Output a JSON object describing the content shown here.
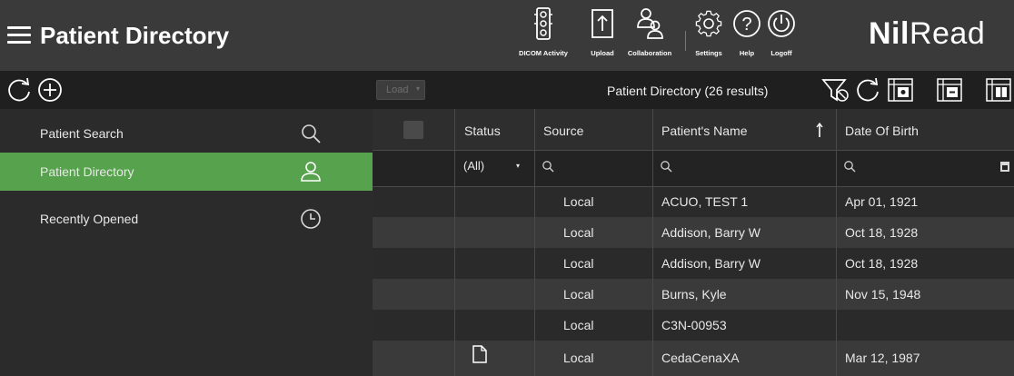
{
  "header": {
    "title": "Patient Directory",
    "brand_bold": "Nil",
    "brand_light": "Read",
    "tools": [
      {
        "label": "DICOM Activity",
        "icon": "traffic-light-icon"
      },
      {
        "label": "Upload",
        "icon": "upload-icon"
      },
      {
        "label": "Collaboration",
        "icon": "users-icon"
      },
      {
        "label": "Settings",
        "icon": "gear-icon"
      },
      {
        "label": "Help",
        "icon": "help-icon"
      },
      {
        "label": "Logoff",
        "icon": "power-icon"
      }
    ]
  },
  "actionbar": {
    "load_label": "Load",
    "results_text": "Patient Directory (26 results)"
  },
  "sidebar": {
    "items": [
      {
        "label": "Patient Search",
        "icon": "search-icon"
      },
      {
        "label": "Patient Directory",
        "icon": "user-icon",
        "active": true
      },
      {
        "label": "Recently Opened",
        "icon": "clock-icon"
      }
    ]
  },
  "table": {
    "columns": [
      "Status",
      "Source",
      "Patient's Name",
      "Date Of Birth"
    ],
    "status_filter": "(All)",
    "rows": [
      {
        "status_icon": "",
        "source": "Local",
        "name": "ACUO, TEST 1",
        "dob": "Apr 01, 1921"
      },
      {
        "status_icon": "",
        "source": "Local",
        "name": "Addison, Barry W",
        "dob": "Oct 18, 1928"
      },
      {
        "status_icon": "",
        "source": "Local",
        "name": "Addison, Barry W",
        "dob": "Oct 18, 1928"
      },
      {
        "status_icon": "",
        "source": "Local",
        "name": "Burns, Kyle",
        "dob": "Nov 15, 1948"
      },
      {
        "status_icon": "",
        "source": "Local",
        "name": "C3N-00953",
        "dob": ""
      },
      {
        "status_icon": "document-icon",
        "source": "Local",
        "name": "CedaCenaXA",
        "dob": "Mar 12, 1987"
      }
    ]
  },
  "colors": {
    "active_item": "#57a24d",
    "topbar": "#3a3a3a",
    "actionbar": "#1f1f1f"
  }
}
